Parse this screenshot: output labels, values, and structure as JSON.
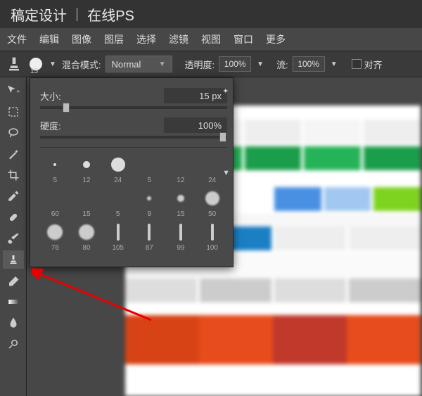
{
  "title": {
    "brand": "稿定设计",
    "product": "在线PS"
  },
  "menu": [
    "文件",
    "编辑",
    "图像",
    "图层",
    "选择",
    "滤镜",
    "视图",
    "窗口",
    "更多"
  ],
  "options": {
    "brush_size_indicator": "15",
    "blend_label": "混合模式:",
    "blend_value": "Normal",
    "opacity_label": "透明度:",
    "opacity_value": "100%",
    "flow_label": "流:",
    "flow_value": "100%",
    "align_label": "对齐"
  },
  "brush_panel": {
    "size_label": "大小:",
    "size_value": "15",
    "size_unit": "px",
    "hardness_label": "硬度:",
    "hardness_value": "100%",
    "presets": [
      {
        "n": "5",
        "d": 4,
        "t": "hard"
      },
      {
        "n": "12",
        "d": 10,
        "t": "hard"
      },
      {
        "n": "24",
        "d": 20,
        "t": "hard"
      },
      {
        "n": "5",
        "d": 4,
        "t": "soft"
      },
      {
        "n": "12",
        "d": 12,
        "t": "soft"
      },
      {
        "n": "24",
        "d": 22,
        "t": "soft"
      },
      {
        "n": "60",
        "d": 22,
        "t": "soft"
      },
      {
        "n": "15",
        "d": 8,
        "t": "soft"
      },
      {
        "n": "5",
        "d": 4,
        "t": "soft"
      },
      {
        "n": "9",
        "d": 6,
        "t": "tex"
      },
      {
        "n": "15",
        "d": 10,
        "t": "tex"
      },
      {
        "n": "50",
        "d": 20,
        "t": "tex"
      },
      {
        "n": "76",
        "d": 22,
        "t": "blob"
      },
      {
        "n": "80",
        "d": 22,
        "t": "blob"
      },
      {
        "n": "105",
        "d": 6,
        "t": "stroke"
      },
      {
        "n": "87",
        "d": 6,
        "t": "stroke"
      },
      {
        "n": "99",
        "d": 6,
        "t": "stroke"
      },
      {
        "n": "100",
        "d": 6,
        "t": "stroke"
      }
    ]
  }
}
